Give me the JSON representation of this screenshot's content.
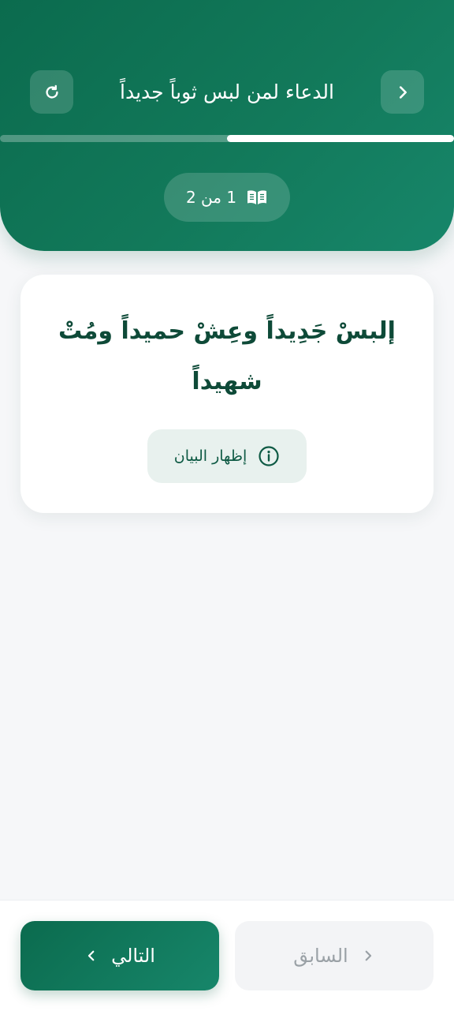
{
  "header": {
    "title": "الدعاء لمن لبس ثوباً جديداً",
    "back_icon": "chevron-right-icon",
    "reset_icon": "refresh-icon",
    "progress": 0.5,
    "counter_text": "1 من 2",
    "counter_icon": "book-icon"
  },
  "card": {
    "dua_text": "إلبسْ جَدِيداً وعِشْ حميداً ومُتْ شهيداً",
    "show_button_label": "إظهار البيان",
    "show_button_icon": "info-icon"
  },
  "footer": {
    "next_label": "التالي",
    "previous_label": "السابق"
  },
  "colors": {
    "primary": "#0b6b4e",
    "primary_light": "#17866a",
    "text_dark_green": "#0e4a38",
    "disabled_text": "#9aa1a6"
  }
}
